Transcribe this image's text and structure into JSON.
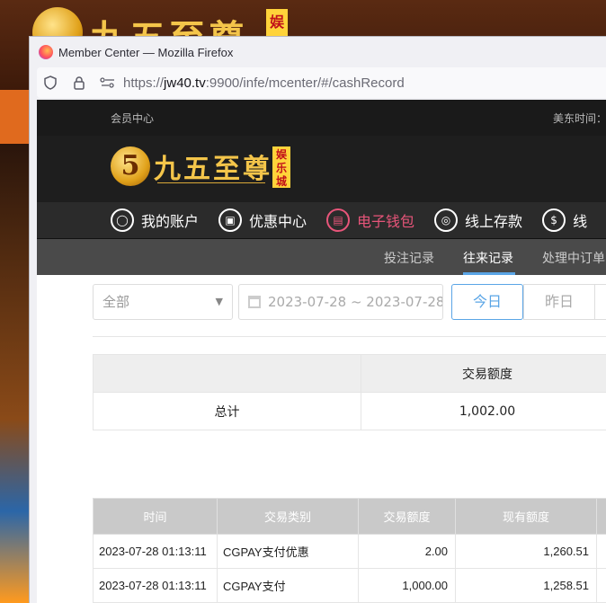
{
  "background_site": {
    "logo_text": "九五至尊",
    "badge": "娱"
  },
  "window": {
    "title": "Member Center — Mozilla Firefox",
    "url_prefix": "https://",
    "url_domain": "jw40.tv",
    "url_rest": ":9900/infe/mcenter/#/cashRecord"
  },
  "site": {
    "top_left": "会员中心",
    "top_right": "美东时间：",
    "logo_mark": "5",
    "logo_text": "九五至尊",
    "logo_badge": "娱乐城"
  },
  "nav": [
    {
      "label": "我的账户",
      "icon": "user-icon",
      "glyph": "◯"
    },
    {
      "label": "优惠中心",
      "icon": "gift-icon",
      "glyph": "▣"
    },
    {
      "label": "电子钱包",
      "icon": "wallet-icon",
      "glyph": "▤"
    },
    {
      "label": "线上存款",
      "icon": "deposit-icon",
      "glyph": "◎"
    },
    {
      "label": "线",
      "icon": "withdraw-icon",
      "glyph": "$"
    }
  ],
  "subnav": {
    "bet": "投注记录",
    "cash": "往来记录",
    "pending": "处理中订单"
  },
  "filters": {
    "type_value": "全部",
    "date_range": "2023-07-28 ~ 2023-07-28",
    "today": "今日",
    "yesterday": "昨日"
  },
  "summary": {
    "header": "交易额度",
    "total_label": "总计",
    "total_value": "1,002.00"
  },
  "records": {
    "headers": [
      "时间",
      "交易类别",
      "交易额度",
      "现有额度"
    ],
    "rows": [
      [
        "2023-07-28 01:13:11",
        "CGPAY支付优惠",
        "2.00",
        "1,260.51"
      ],
      [
        "2023-07-28 01:13:11",
        "CGPAY支付",
        "1,000.00",
        "1,258.51"
      ]
    ]
  },
  "colors": {
    "accent": "#5aa5e6",
    "active_nav": "#e8557a",
    "gold": "#f4c54a"
  }
}
